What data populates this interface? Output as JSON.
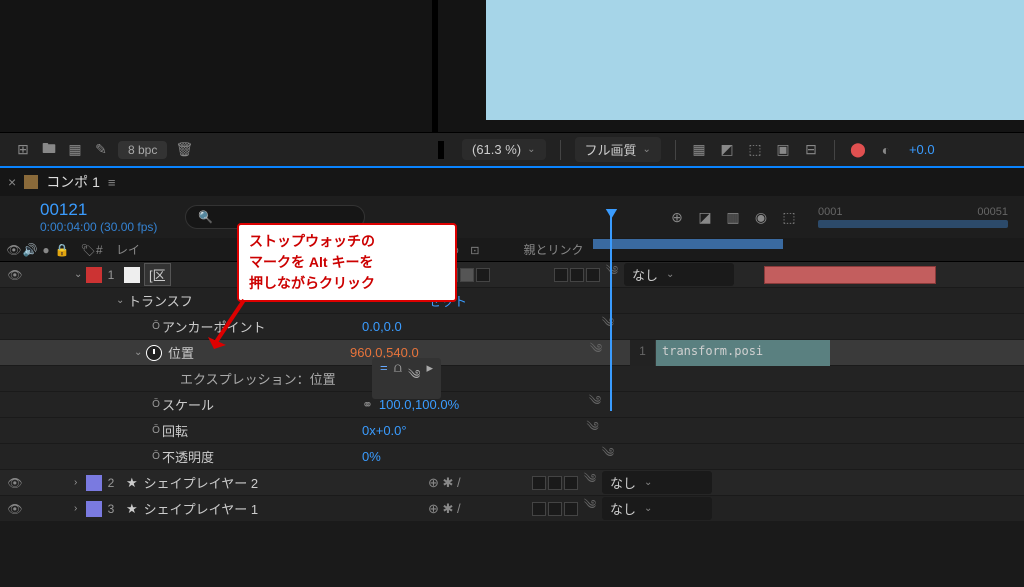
{
  "toolbar": {
    "bpc": "8 bpc",
    "zoom": "(61.3 %)",
    "quality": "フル画質",
    "exposure": "+0.0"
  },
  "timeline": {
    "comp_name": "コンポ 1",
    "frame": "00121",
    "timecode": "0:00:04:00 (30.00 fps)",
    "search_placeholder": "",
    "ruler": {
      "start": "0001",
      "mid": "00051"
    }
  },
  "columns": {
    "layer_name": "レイ",
    "switches": "ヰ☆、fx圓",
    "parent_link": "親とリンク"
  },
  "layers": [
    {
      "num": "1",
      "color": "#c33",
      "name": "区",
      "parent": "なし"
    },
    {
      "num": "2",
      "color": "#7a7ae0",
      "name": "シェイプレイヤー 2",
      "parent": "なし"
    },
    {
      "num": "3",
      "color": "#7a7ae0",
      "name": "シェイプレイヤー 1",
      "parent": "なし"
    }
  ],
  "transform": {
    "group": "トランスフ",
    "reset": "セット",
    "anchor": {
      "label": "アンカーポイント",
      "value": "0.0,0.0"
    },
    "position": {
      "label": "位置",
      "value": "960.0,540.0"
    },
    "expression_label": "エクスプレッション：位置",
    "scale": {
      "label": "スケール",
      "value": "100.0,100.0%"
    },
    "rotation": {
      "label": "回転",
      "value_a": "0",
      "value_b": "x+0.0°"
    },
    "opacity": {
      "label": "不透明度",
      "value": "0%"
    }
  },
  "expression": {
    "line_num": "1",
    "code": "transform.posi"
  },
  "callout": {
    "line1": "ストップウォッチの",
    "line2": "マークを Alt キーを",
    "line3": "押しながらクリック"
  },
  "none_label": "なし",
  "menu_glyph": "≡"
}
